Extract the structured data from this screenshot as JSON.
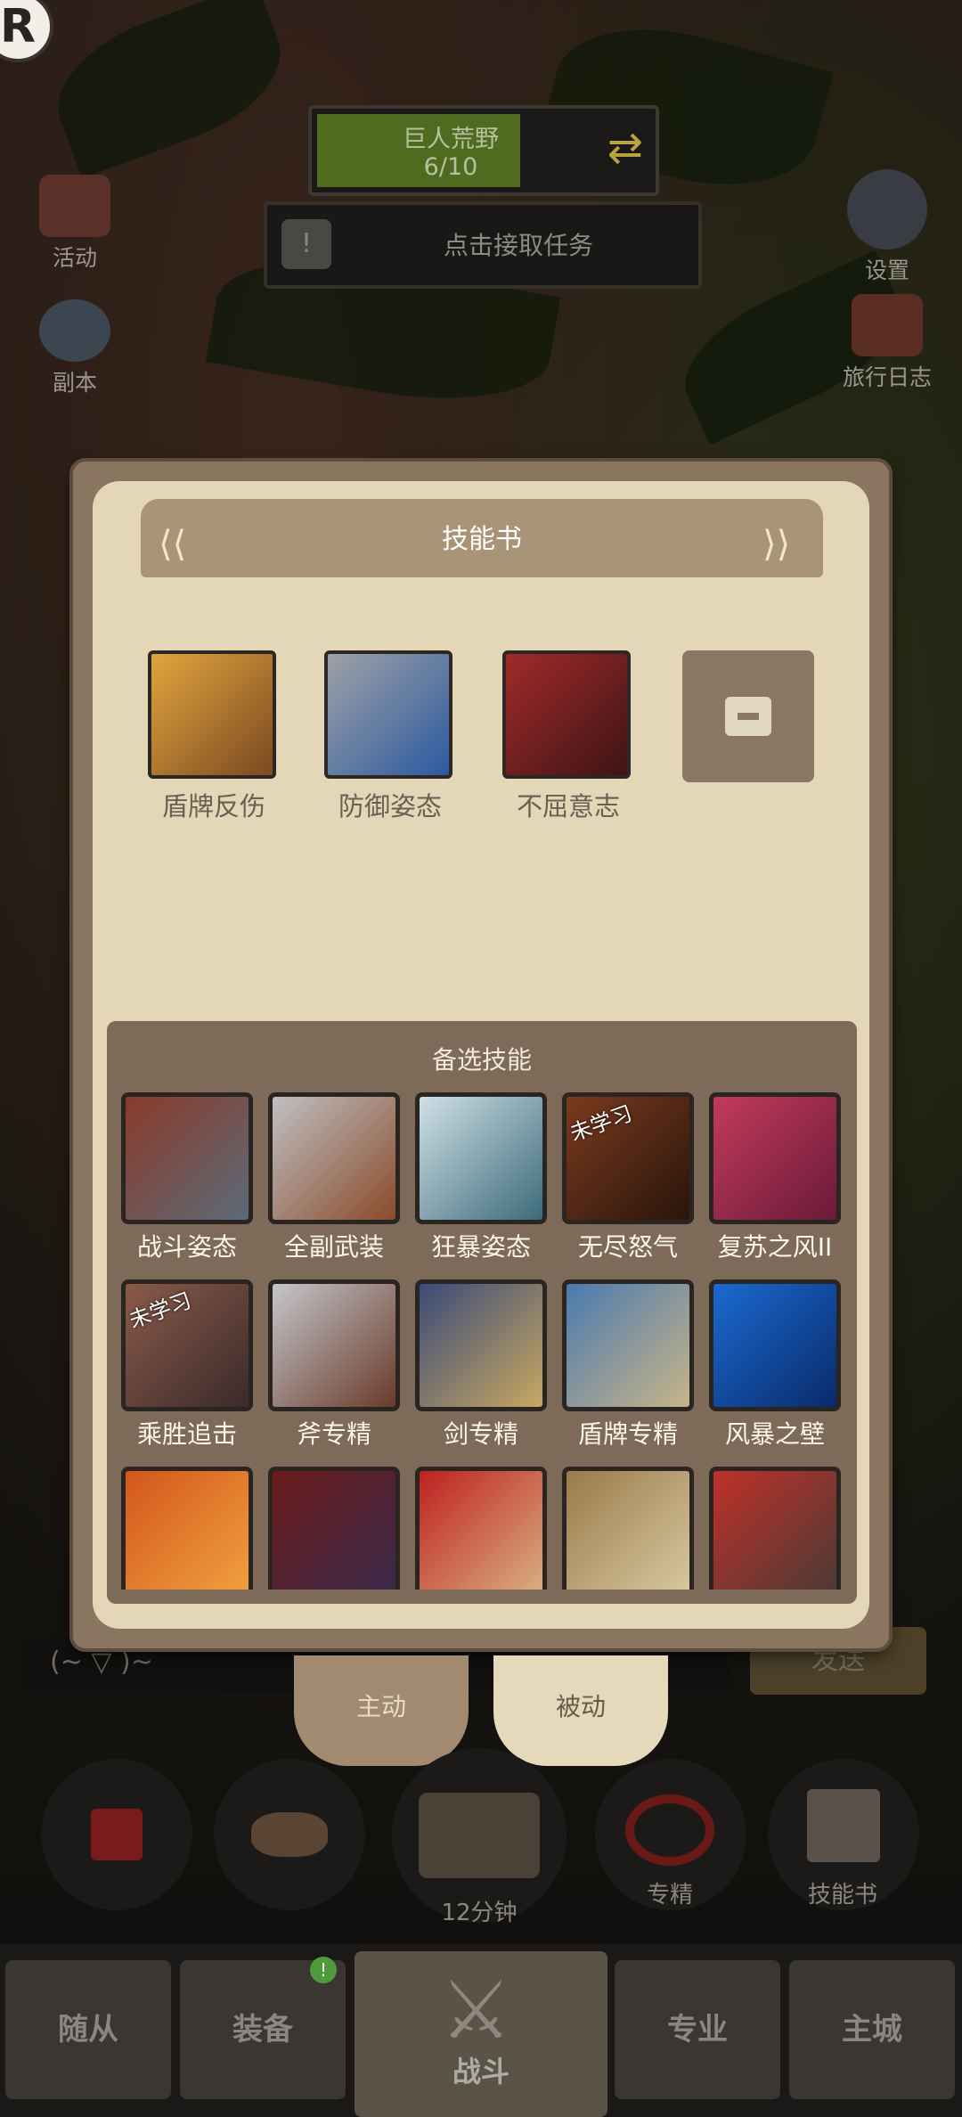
{
  "hud": {
    "zone_name": "巨人荒野",
    "zone_progress": "6/10",
    "zone_progress_fraction": 0.6,
    "quest_prompt": "点击接取任务",
    "left_menu": [
      {
        "label": "活动",
        "icon": "calendar-icon"
      },
      {
        "label": "副本",
        "icon": "dungeon-icon"
      }
    ],
    "right_menu": [
      {
        "label": "设置",
        "icon": "gear-icon"
      },
      {
        "label": "旅行日志",
        "icon": "journal-icon"
      }
    ]
  },
  "skill_book": {
    "title": "技能书",
    "equipped": [
      {
        "name": "盾牌反伤",
        "colors": [
          "#e0a43c",
          "#7a4a22"
        ]
      },
      {
        "name": "防御姿态",
        "colors": [
          "#9ea1a6",
          "#2c5aa0"
        ]
      },
      {
        "name": "不屈意志",
        "colors": [
          "#a12a2a",
          "#3d1414"
        ]
      }
    ],
    "empty_slot_icon": "lock-icon",
    "alternatives_title": "备选技能",
    "unlearned_label": "未学习",
    "alternatives": [
      {
        "name": "战斗姿态",
        "learned": true,
        "colors": [
          "#8a3a2a",
          "#5c6a78"
        ]
      },
      {
        "name": "全副武装",
        "learned": true,
        "colors": [
          "#bfc0c2",
          "#8a4a2a"
        ]
      },
      {
        "name": "狂暴姿态",
        "learned": true,
        "colors": [
          "#cfe0e6",
          "#3d6a7a"
        ]
      },
      {
        "name": "无尽怒气",
        "learned": false,
        "colors": [
          "#7a3a1e",
          "#2a140a"
        ]
      },
      {
        "name": "复苏之风II",
        "learned": true,
        "colors": [
          "#c23a5a",
          "#6a1a3a"
        ]
      },
      {
        "name": "乘胜追击",
        "learned": false,
        "colors": [
          "#8a5a4a",
          "#3a2a2a"
        ]
      },
      {
        "name": "斧专精",
        "learned": true,
        "colors": [
          "#c4c6ca",
          "#6a3a2a"
        ]
      },
      {
        "name": "剑专精",
        "learned": true,
        "colors": [
          "#3a4a7a",
          "#c8a860"
        ]
      },
      {
        "name": "盾牌专精",
        "learned": true,
        "colors": [
          "#4a7ab0",
          "#c8b488"
        ]
      },
      {
        "name": "风暴之壁",
        "learned": true,
        "colors": [
          "#1a6ad0",
          "#0a2a6a"
        ]
      },
      {
        "name": "",
        "learned": true,
        "colors": [
          "#d4561a",
          "#f0a040"
        ]
      },
      {
        "name": "",
        "learned": true,
        "colors": [
          "#6a1a1a",
          "#3a2a4a"
        ]
      },
      {
        "name": "",
        "learned": true,
        "colors": [
          "#c02020",
          "#d8b080"
        ]
      },
      {
        "name": "",
        "learned": true,
        "colors": [
          "#9a7a4a",
          "#d8c8a0"
        ]
      },
      {
        "name": "",
        "learned": true,
        "colors": [
          "#c0302a",
          "#4a3a34"
        ]
      }
    ]
  },
  "subtabs": {
    "active_label": "主动",
    "passive_label": "被动"
  },
  "chat": {
    "placeholder": "(~ ▽ )~",
    "send_label": "发送"
  },
  "actions": [
    {
      "label": "",
      "icon": "potion-icon"
    },
    {
      "label": "",
      "icon": "bread-icon"
    },
    {
      "label": "12分钟",
      "icon": "chest-icon"
    },
    {
      "label": "专精",
      "icon": "mastery-icon"
    },
    {
      "label": "技能书",
      "icon": "skill-book-icon"
    }
  ],
  "nav": {
    "items": [
      "随从",
      "装备",
      "战斗",
      "专业",
      "主城"
    ],
    "active": "战斗",
    "badge": "!"
  }
}
